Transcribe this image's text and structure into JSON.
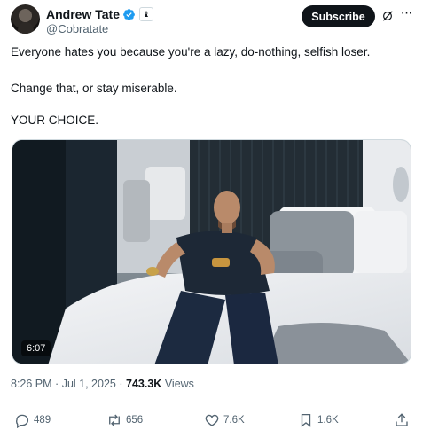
{
  "author": {
    "name": "Andrew Tate",
    "handle": "@Cobratate",
    "badge_glyph": "♝",
    "verified_color": "#1d9bf0"
  },
  "subscribe_label": "Subscribe",
  "more_glyph": "···",
  "tweet": {
    "line1": "Everyone hates you because you're a lazy, do-nothing, selfish loser.",
    "line2": "Change that, or stay miserable.",
    "line3": "YOUR CHOICE."
  },
  "video": {
    "duration": "6:07"
  },
  "meta": {
    "time": "8:26 PM",
    "separator1": "·",
    "date": "Jul 1, 2025",
    "separator2": "·",
    "views_count": "743.3K",
    "views_label": "Views"
  },
  "actions": {
    "replies": "489",
    "reposts": "656",
    "likes": "7.6K",
    "bookmarks": "1.6K"
  },
  "icons": {
    "reply": "reply-icon",
    "repost": "repost-icon",
    "like": "heart-icon",
    "bookmark": "bookmark-icon",
    "share": "share-icon",
    "grok": "grok-icon"
  },
  "colors": {
    "text": "#0f1419",
    "secondary": "#536471",
    "subscribe_bg": "#0f1419"
  }
}
